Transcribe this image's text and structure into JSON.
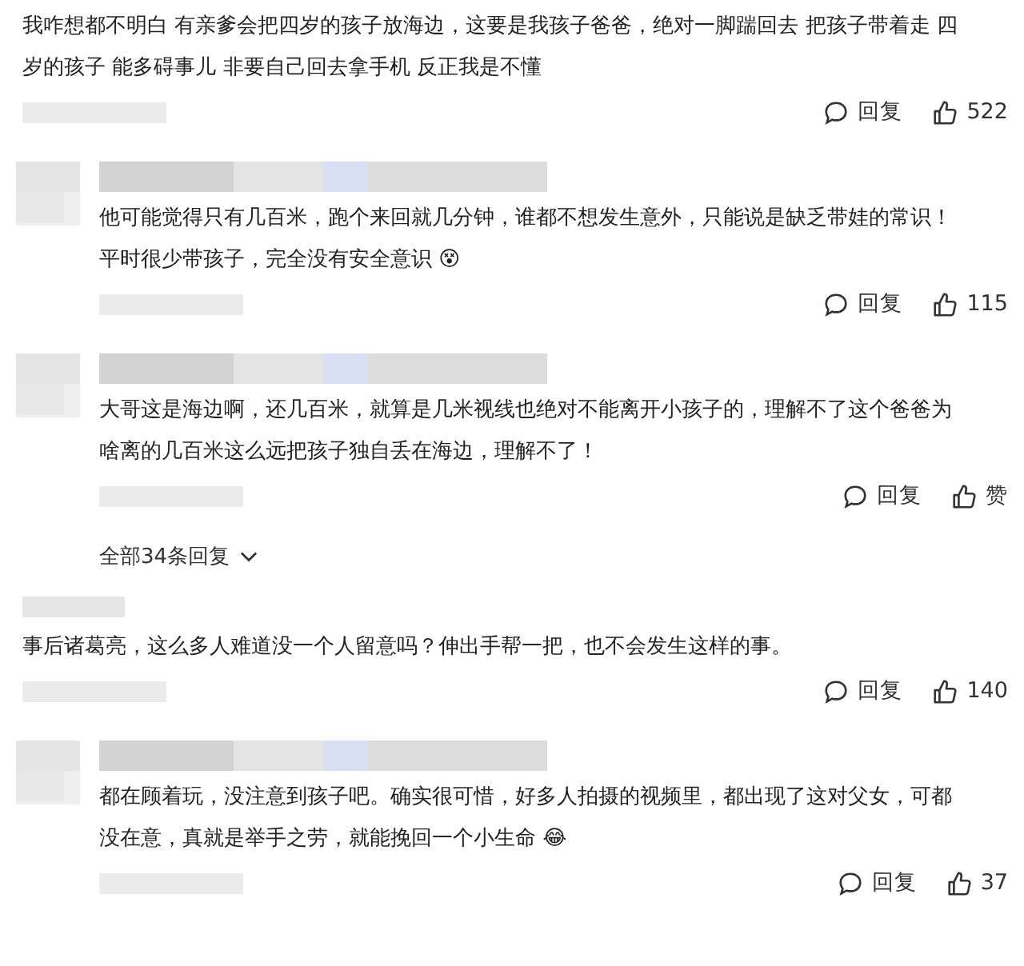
{
  "comments": [
    {
      "kind": "plain",
      "lines": [
        "我咋想都不明白 有亲爹会把四岁的孩子放海边，这要是我孩子爸爸，绝对一脚踹回去 把孩子带着走 四",
        "岁的孩子 能多碍事儿 非要自己回去拿手机 反正我是不懂"
      ],
      "reply_label": "回复",
      "likes": "522"
    },
    {
      "kind": "avatar",
      "lines": [
        "他可能觉得只有几百米，跑个来回就几分钟，谁都不想发生意外，只能说是缺乏带娃的常识！",
        "平时很少带孩子，完全没有安全意识 😵"
      ],
      "reply_label": "回复",
      "likes": "115"
    },
    {
      "kind": "avatar",
      "lines": [
        "大哥这是海边啊，还几百米，就算是几米视线也绝对不能离开小孩子的，理解不了这个爸爸为",
        "啥离的几百米这么远把孩子独自丢在海边，理解不了！"
      ],
      "reply_label": "回复",
      "likes": "赞",
      "more_replies": "全部34条回复"
    },
    {
      "kind": "plain",
      "lines": [
        "事后诸葛亮，这么多人难道没一个人留意吗？伸出手帮一把，也不会发生这样的事。"
      ],
      "reply_label": "回复",
      "likes": "140"
    },
    {
      "kind": "avatar",
      "lines": [
        "都在顾着玩，没注意到孩子吧。确实很可惜，好多人拍摄的视频里，都出现了这对父女，可都",
        "没在意，真就是举手之劳，就能挽回一个小生命 😂"
      ],
      "reply_label": "回复",
      "likes": "37"
    }
  ]
}
